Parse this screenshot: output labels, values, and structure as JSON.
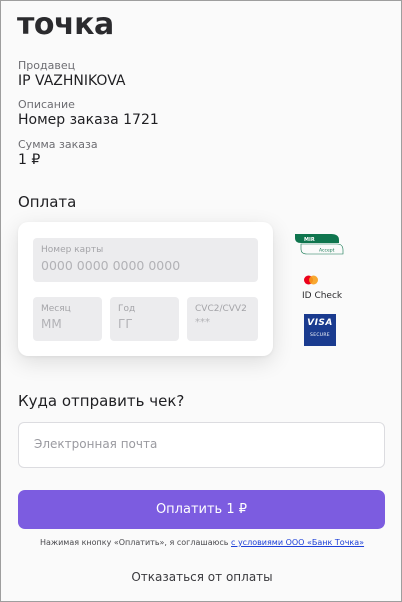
{
  "brand": {
    "logo_text": "точка"
  },
  "order": {
    "seller_label": "Продавец",
    "seller_value": "IP VAZHNIKOVA",
    "description_label": "Описание",
    "description_value": "Номер заказа 1721",
    "amount_label": "Сумма заказа",
    "amount_value": "1 ₽"
  },
  "payment": {
    "title": "Оплата",
    "card_number": {
      "label": "Номер карты",
      "placeholder": "0000 0000 0000 0000"
    },
    "month": {
      "label": "Месяц",
      "placeholder": "ММ"
    },
    "year": {
      "label": "Год",
      "placeholder": "ГГ"
    },
    "cvc": {
      "label": "CVC2/CVV2",
      "placeholder": "***"
    }
  },
  "badges": {
    "mir_text": "MIR",
    "mir_accept": "Accept",
    "mastercard_caption": "ID Check",
    "visa_text": "VISA",
    "visa_secure": "SECURE",
    "colors": {
      "mir_green": "#0f754e",
      "mc_red": "#eb001b",
      "mc_orange": "#f79e1b",
      "visa_blue": "#1a3b8f"
    }
  },
  "receipt": {
    "title": "Куда отправить чек?",
    "email_placeholder": "Электронная почта"
  },
  "actions": {
    "pay_label": "Оплатить 1 ₽",
    "consent_prefix": "Нажимая кнопку «Оплатить», я соглашаюсь ",
    "consent_link": "с условиями ООО «Банк Точка»",
    "cancel_label": "Отказаться от оплаты"
  },
  "theme": {
    "accent": "#7c5ce0",
    "link": "#1c3fd8"
  }
}
